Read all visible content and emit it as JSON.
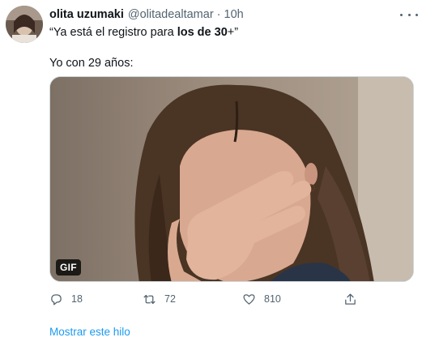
{
  "tweet": {
    "author_name": "olita uzumaki",
    "author_handle": "@olitadealtamar",
    "separator": "·",
    "time": "10h",
    "text_quote_open": "“Ya está el registro para ",
    "text_quote_bold": "los de 30",
    "text_quote_close": "+”",
    "text_line2": "Yo con 29 años:",
    "media_badge": "GIF",
    "reply_count": "18",
    "retweet_count": "72",
    "like_count": "810",
    "show_thread": "Mostrar este hilo"
  },
  "icons": {
    "avatar": "avatar-photo",
    "more": "more-options-icon",
    "reply": "reply-icon",
    "retweet": "retweet-icon",
    "like": "heart-icon",
    "share": "share-icon"
  },
  "colors": {
    "text": "#0f1419",
    "muted": "#536471",
    "link": "#1d9bf0",
    "border": "#cfd9de"
  }
}
